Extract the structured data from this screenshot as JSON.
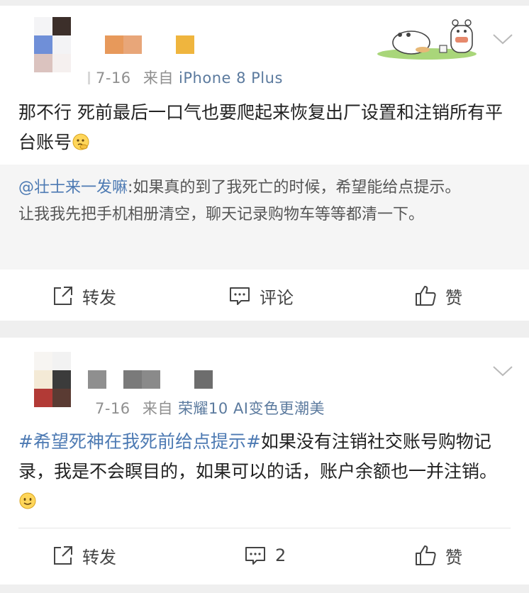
{
  "posts": [
    {
      "meta_date": "7-16",
      "meta_from": "来自",
      "meta_source": "iPhone 8 Plus",
      "content_text": "那不行 死前最后一口气也要爬起来恢复出厂设置和注销所有平台账号",
      "content_emoji": "thinking-emoji",
      "quote": {
        "mention": "@壮士来一发嘛",
        "line1_rest": ":如果真的到了我死亡的时候，希望能给点提示。",
        "line2": "让我我先把手机相册清空，聊天记录购物车等等都清一下。"
      },
      "actions": {
        "repost_label": "转发",
        "comment_label": "评论",
        "like_label": "赞"
      }
    },
    {
      "meta_date": "7-16",
      "meta_from": "来自",
      "meta_source": "荣耀10 AI变色更潮美",
      "hashtag": "#希望死神在我死前给点提示#",
      "content_text": "如果没有注销社交账号购物记录，我是不会瞑目的，如果可以的话，账户余额也一并注销。",
      "content_emoji": "smile-emoji",
      "actions": {
        "repost_label": "转发",
        "comment_count": "2",
        "like_label": "赞"
      }
    }
  ],
  "icons": [
    "pixelated-avatar",
    "cartoon-sticker",
    "chevron-down-icon",
    "repost-icon",
    "comment-icon",
    "like-icon"
  ],
  "colors": {
    "link": "#4d7ab3",
    "source": "#5b7a9e",
    "meta": "#8f8f8f",
    "quote_bg": "#f5f5f5",
    "page_bg": "#efefef"
  }
}
